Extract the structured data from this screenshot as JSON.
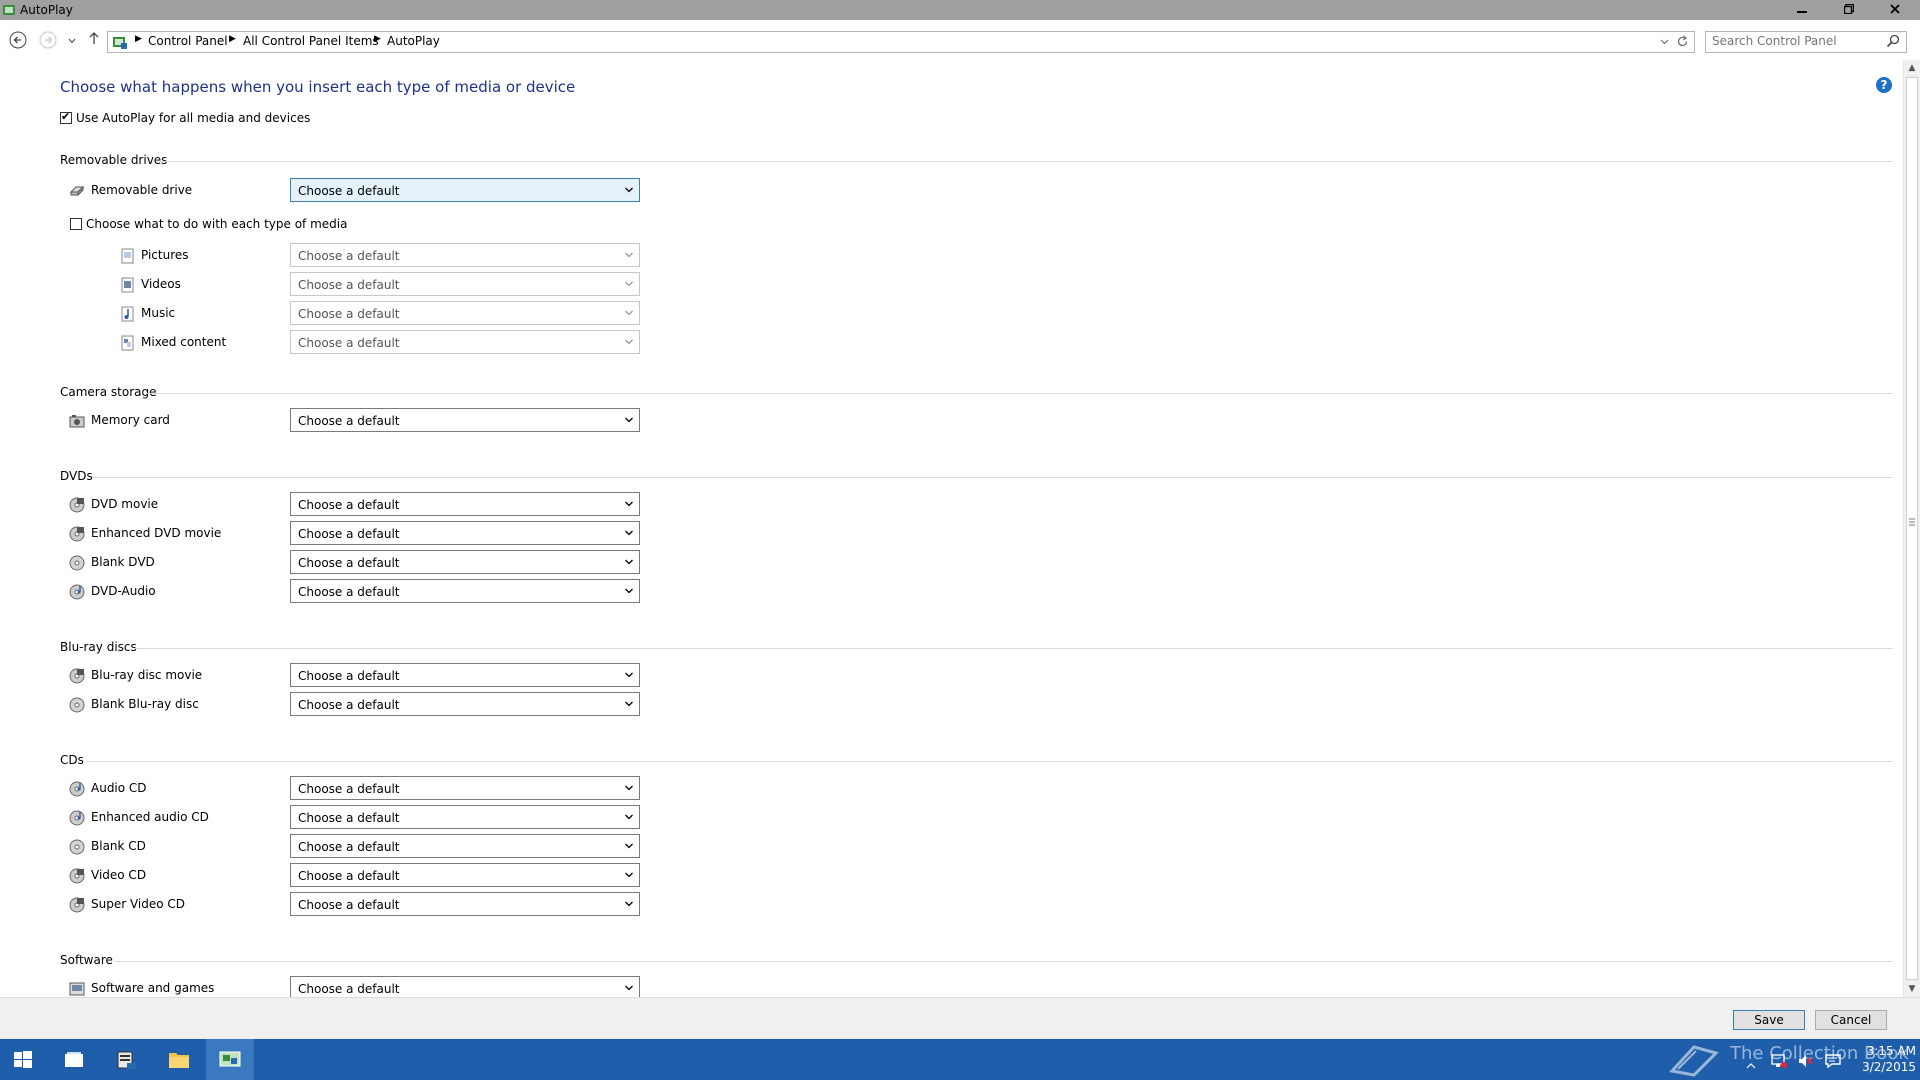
{
  "window": {
    "title": "AutoPlay"
  },
  "breadcrumb": [
    "Control Panel",
    "All Control Panel Items",
    "AutoPlay"
  ],
  "search": {
    "placeholder": "Search Control Panel"
  },
  "content": {
    "heading": "Choose what happens when you insert each type of media or device",
    "use_autoplay": {
      "label": "Use AutoPlay for all media and devices",
      "checked": true
    },
    "choose_each_media": {
      "label": "Choose what to do with each type of media",
      "checked": false
    },
    "default_placeholder": "Choose a default",
    "sections": {
      "removable": "Removable drives",
      "camera": "Camera storage",
      "dvds": "DVDs",
      "bluray": "Blu-ray discs",
      "cds": "CDs",
      "software": "Software"
    },
    "devices": {
      "removable_drive": "Removable drive",
      "pictures": "Pictures",
      "videos": "Videos",
      "music": "Music",
      "mixed_content": "Mixed content",
      "memory_card": "Memory card",
      "dvd_movie": "DVD movie",
      "enhanced_dvd_movie": "Enhanced DVD movie",
      "blank_dvd": "Blank DVD",
      "dvd_audio": "DVD-Audio",
      "bluray_movie": "Blu-ray disc movie",
      "blank_bluray": "Blank Blu-ray disc",
      "audio_cd": "Audio CD",
      "enhanced_audio_cd": "Enhanced audio CD",
      "blank_cd": "Blank CD",
      "video_cd": "Video CD",
      "super_video_cd": "Super Video CD",
      "software_games": "Software and games"
    }
  },
  "footer": {
    "save": "Save",
    "cancel": "Cancel"
  },
  "taskbar": {
    "time": "3:15 AM",
    "date": "3/2/2015",
    "watermark": "The Collection Book"
  },
  "colors": {
    "heading": "#1e3287",
    "taskbar": "#1e5eab",
    "titlebar": "#a0a0a0"
  }
}
